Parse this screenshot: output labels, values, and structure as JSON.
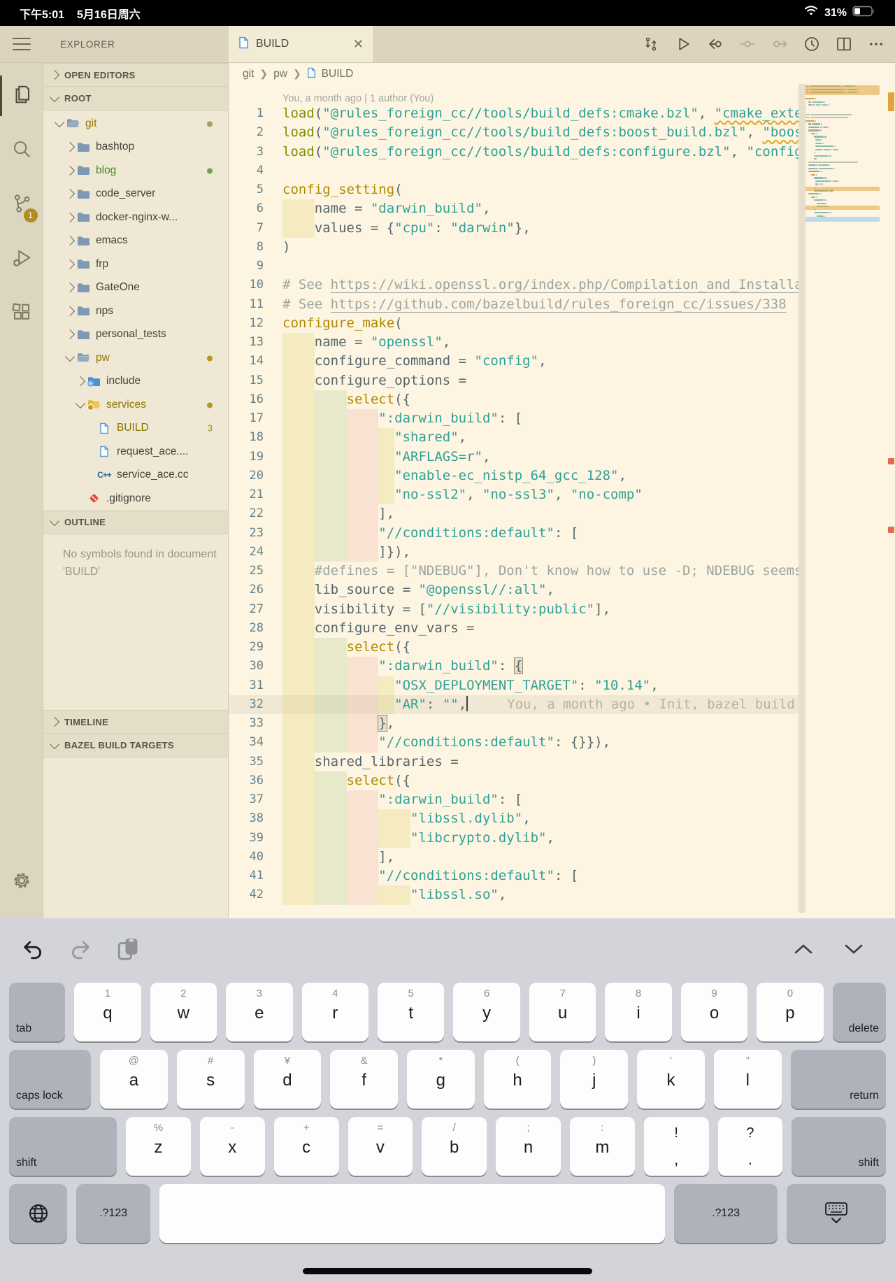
{
  "status": {
    "time": "下午5:01",
    "date": "5月16日周六",
    "battery": "31%"
  },
  "activity_bar": {
    "scm_badge": "1",
    "items": [
      "explorer",
      "search",
      "source-control",
      "run-debug",
      "extensions"
    ]
  },
  "explorer": {
    "title": "EXPLORER",
    "open_editors_label": "OPEN EDITORS",
    "root_label": "ROOT",
    "outline_label": "OUTLINE",
    "outline_message": "No symbols found in document 'BUILD'",
    "timeline_label": "TIMELINE",
    "bazel_label": "BAZEL BUILD TARGETS",
    "tree": [
      {
        "name": "git",
        "depth": 0,
        "state": "open",
        "icon": "folder-open",
        "color": "mod",
        "badge": "dot",
        "badge_color": "#AD9C6B"
      },
      {
        "name": "bashtop",
        "depth": 1,
        "state": "closed",
        "icon": "folder",
        "color": "def"
      },
      {
        "name": "blog",
        "depth": 1,
        "state": "closed",
        "icon": "folder",
        "color": "new",
        "badge": "dot",
        "badge_color": "#74A053"
      },
      {
        "name": "code_server",
        "depth": 1,
        "state": "closed",
        "icon": "folder",
        "color": "def"
      },
      {
        "name": "docker-nginx-w...",
        "depth": 1,
        "state": "closed",
        "icon": "folder",
        "color": "def"
      },
      {
        "name": "emacs",
        "depth": 1,
        "state": "closed",
        "icon": "folder",
        "color": "def"
      },
      {
        "name": "frp",
        "depth": 1,
        "state": "closed",
        "icon": "folder",
        "color": "def"
      },
      {
        "name": "GateOne",
        "depth": 1,
        "state": "closed",
        "icon": "folder",
        "color": "def"
      },
      {
        "name": "nps",
        "depth": 1,
        "state": "closed",
        "icon": "folder",
        "color": "def"
      },
      {
        "name": "personal_tests",
        "depth": 1,
        "state": "closed",
        "icon": "folder",
        "color": "def"
      },
      {
        "name": "pw",
        "depth": 1,
        "state": "open",
        "icon": "folder-open",
        "color": "mod",
        "badge": "dot",
        "badge_color": "#B59525"
      },
      {
        "name": "include",
        "depth": 2,
        "state": "closed",
        "icon": "folder-include",
        "color": "def"
      },
      {
        "name": "services",
        "depth": 2,
        "state": "open",
        "icon": "folder-services",
        "color": "mod",
        "badge": "dot",
        "badge_color": "#B59525"
      },
      {
        "name": "BUILD",
        "depth": 3,
        "state": "file",
        "icon": "file",
        "color": "mod",
        "badge": "3",
        "badge_color": "#A8891B"
      },
      {
        "name": "request_ace....",
        "depth": 3,
        "state": "file",
        "icon": "file",
        "color": "def"
      },
      {
        "name": "service_ace.cc",
        "depth": 3,
        "state": "file",
        "icon": "cpp",
        "color": "def"
      },
      {
        "name": ".gitignore",
        "depth": 2,
        "state": "file",
        "icon": "gitignore",
        "color": "def"
      }
    ]
  },
  "editor": {
    "tab_label": "BUILD",
    "breadcrumb": [
      "git",
      "pw",
      "BUILD"
    ],
    "codelens": "You, a month ago | 1 author (You)",
    "current_line": 32,
    "lines": [
      {
        "n": 1,
        "i": 0,
        "t": [
          [
            "kw",
            "load"
          ],
          [
            "p",
            "("
          ],
          [
            "str",
            "\"@rules_foreign_cc//tools/build_defs:cmake.bzl\""
          ],
          [
            "p",
            ", "
          ],
          [
            "sq",
            "\"cmake_external\""
          ],
          [
            "p",
            ")"
          ]
        ]
      },
      {
        "n": 2,
        "i": 0,
        "t": [
          [
            "kw",
            "load"
          ],
          [
            "p",
            "("
          ],
          [
            "str",
            "\"@rules_foreign_cc//tools/build_defs:boost_build.bzl\""
          ],
          [
            "p",
            ", "
          ],
          [
            "sq",
            "\"boost_build\""
          ],
          [
            "p",
            ")"
          ]
        ]
      },
      {
        "n": 3,
        "i": 0,
        "t": [
          [
            "kw",
            "load"
          ],
          [
            "p",
            "("
          ],
          [
            "str",
            "\"@rules_foreign_cc//tools/build_defs:configure.bzl\""
          ],
          [
            "p",
            ", "
          ],
          [
            "str",
            "\"configure_make\""
          ],
          [
            "p",
            ")"
          ]
        ]
      },
      {
        "n": 4,
        "i": 0,
        "t": []
      },
      {
        "n": 5,
        "i": 0,
        "t": [
          [
            "fn",
            "config_setting"
          ],
          [
            "p",
            "("
          ]
        ]
      },
      {
        "n": 6,
        "i": 4,
        "t": [
          [
            "df",
            "name"
          ],
          [
            "p",
            " = "
          ],
          [
            "str",
            "\"darwin_build\""
          ],
          [
            "p",
            ","
          ]
        ]
      },
      {
        "n": 7,
        "i": 4,
        "t": [
          [
            "df",
            "values"
          ],
          [
            "p",
            " = {"
          ],
          [
            "str",
            "\"cpu\""
          ],
          [
            "p",
            ": "
          ],
          [
            "str",
            "\"darwin\""
          ],
          [
            "p",
            "},"
          ]
        ]
      },
      {
        "n": 8,
        "i": 0,
        "t": [
          [
            "p",
            ")"
          ]
        ]
      },
      {
        "n": 9,
        "i": 0,
        "t": []
      },
      {
        "n": 10,
        "i": 0,
        "t": [
          [
            "cm",
            "# See "
          ],
          [
            "lk",
            "https://wiki.openssl.org/index.php/Compilation_and_Installation"
          ]
        ]
      },
      {
        "n": 11,
        "i": 0,
        "t": [
          [
            "cm",
            "# See "
          ],
          [
            "lk",
            "https://github.com/bazelbuild/rules_foreign_cc/issues/338"
          ]
        ]
      },
      {
        "n": 12,
        "i": 0,
        "t": [
          [
            "fn",
            "configure_make"
          ],
          [
            "p",
            "("
          ]
        ]
      },
      {
        "n": 13,
        "i": 4,
        "t": [
          [
            "df",
            "name"
          ],
          [
            "p",
            " = "
          ],
          [
            "str",
            "\"openssl\""
          ],
          [
            "p",
            ","
          ]
        ]
      },
      {
        "n": 14,
        "i": 4,
        "t": [
          [
            "df",
            "configure_command"
          ],
          [
            "p",
            " = "
          ],
          [
            "str",
            "\"config\""
          ],
          [
            "p",
            ","
          ]
        ]
      },
      {
        "n": 15,
        "i": 4,
        "t": [
          [
            "df",
            "configure_options"
          ],
          [
            "p",
            " ="
          ]
        ]
      },
      {
        "n": 16,
        "i": 8,
        "t": [
          [
            "fn",
            "select"
          ],
          [
            "p",
            "({"
          ]
        ]
      },
      {
        "n": 17,
        "i": 12,
        "t": [
          [
            "str",
            "\":darwin_build\""
          ],
          [
            "p",
            ": ["
          ]
        ]
      },
      {
        "n": 18,
        "i": 14,
        "t": [
          [
            "str",
            "\"shared\""
          ],
          [
            "p",
            ","
          ]
        ]
      },
      {
        "n": 19,
        "i": 14,
        "t": [
          [
            "str",
            "\"ARFLAGS=r\""
          ],
          [
            "p",
            ","
          ]
        ]
      },
      {
        "n": 20,
        "i": 14,
        "t": [
          [
            "str",
            "\"enable-ec_nistp_64_gcc_128\""
          ],
          [
            "p",
            ","
          ]
        ]
      },
      {
        "n": 21,
        "i": 14,
        "t": [
          [
            "str",
            "\"no-ssl2\""
          ],
          [
            "p",
            ", "
          ],
          [
            "str",
            "\"no-ssl3\""
          ],
          [
            "p",
            ", "
          ],
          [
            "str",
            "\"no-comp\""
          ]
        ]
      },
      {
        "n": 22,
        "i": 12,
        "t": [
          [
            "p",
            "],"
          ]
        ]
      },
      {
        "n": 23,
        "i": 12,
        "t": [
          [
            "str",
            "\"//conditions:default\""
          ],
          [
            "p",
            ": ["
          ]
        ]
      },
      {
        "n": 24,
        "i": 12,
        "t": [
          [
            "p",
            "]}),"
          ]
        ]
      },
      {
        "n": 25,
        "i": 4,
        "t": [
          [
            "cm",
            "#defines = [\"NDEBUG\"], Don't know how to use -D; NDEBUG seems to be defined"
          ]
        ]
      },
      {
        "n": 26,
        "i": 4,
        "t": [
          [
            "df",
            "lib_source"
          ],
          [
            "p",
            " = "
          ],
          [
            "str",
            "\"@openssl//:all\""
          ],
          [
            "p",
            ","
          ]
        ]
      },
      {
        "n": 27,
        "i": 4,
        "t": [
          [
            "df",
            "visibility"
          ],
          [
            "p",
            " = ["
          ],
          [
            "str",
            "\"//visibility:public\""
          ],
          [
            "p",
            "],"
          ]
        ]
      },
      {
        "n": 28,
        "i": 4,
        "t": [
          [
            "df",
            "configure_env_vars"
          ],
          [
            "p",
            " ="
          ]
        ]
      },
      {
        "n": 29,
        "i": 8,
        "t": [
          [
            "fn",
            "select"
          ],
          [
            "p",
            "({"
          ]
        ]
      },
      {
        "n": 30,
        "i": 12,
        "t": [
          [
            "str",
            "\":darwin_build\""
          ],
          [
            "p",
            ": "
          ],
          [
            "bm",
            "{"
          ]
        ]
      },
      {
        "n": 31,
        "i": 14,
        "t": [
          [
            "str",
            "\"OSX_DEPLOYMENT_TARGET\""
          ],
          [
            "p",
            ": "
          ],
          [
            "str",
            "\"10.14\""
          ],
          [
            "p",
            ","
          ]
        ]
      },
      {
        "n": 32,
        "i": 14,
        "t": [
          [
            "str",
            "\"AR\""
          ],
          [
            "p",
            ": "
          ],
          [
            "str",
            "\"\""
          ],
          [
            "p",
            ","
          ]
        ],
        "cursor": true,
        "blame": "You, a month ago • Init, bazel build openssl"
      },
      {
        "n": 33,
        "i": 12,
        "t": [
          [
            "bm",
            "}"
          ],
          [
            "p",
            ","
          ]
        ]
      },
      {
        "n": 34,
        "i": 12,
        "t": [
          [
            "str",
            "\"//conditions:default\""
          ],
          [
            "p",
            ": {}}),"
          ]
        ]
      },
      {
        "n": 35,
        "i": 4,
        "t": [
          [
            "df",
            "shared_libraries"
          ],
          [
            "p",
            " ="
          ]
        ]
      },
      {
        "n": 36,
        "i": 8,
        "t": [
          [
            "fn",
            "select"
          ],
          [
            "p",
            "({"
          ]
        ]
      },
      {
        "n": 37,
        "i": 12,
        "t": [
          [
            "str",
            "\":darwin_build\""
          ],
          [
            "p",
            ": ["
          ]
        ]
      },
      {
        "n": 38,
        "i": 16,
        "t": [
          [
            "str",
            "\"libssl.dylib\""
          ],
          [
            "p",
            ","
          ]
        ]
      },
      {
        "n": 39,
        "i": 16,
        "t": [
          [
            "str",
            "\"libcrypto.dylib\""
          ],
          [
            "p",
            ","
          ]
        ]
      },
      {
        "n": 40,
        "i": 12,
        "t": [
          [
            "p",
            "],"
          ]
        ]
      },
      {
        "n": 41,
        "i": 12,
        "t": [
          [
            "str",
            "\"//conditions:default\""
          ],
          [
            "p",
            ": ["
          ]
        ]
      },
      {
        "n": 42,
        "i": 16,
        "t": [
          [
            "str",
            "\"libssl.so\""
          ],
          [
            "p",
            ","
          ]
        ]
      }
    ],
    "toolbar_icons": [
      "compare-changes-icon",
      "run-icon",
      "navigate-back-icon",
      "center-layout-icon",
      "navigate-forward-icon",
      "history-icon",
      "split-editor-icon",
      "more-actions-icon"
    ]
  },
  "colors": {
    "accent_gold": "#B08A00",
    "string_teal": "#2FA198",
    "keyword_olive": "#7E8F01",
    "editor_bg": "#FDF5E1",
    "sidebar_bg": "#EFE8D4",
    "modified_band": "#E2A33C",
    "current_line_band": "#9EC9EA"
  },
  "keyboard": {
    "rows": [
      [
        {
          "k": "special",
          "label": "tab",
          "flex": 0.84,
          "align": "bl"
        },
        {
          "k": "letter",
          "main": "q",
          "sub": "1"
        },
        {
          "k": "letter",
          "main": "w",
          "sub": "2"
        },
        {
          "k": "letter",
          "main": "e",
          "sub": "3"
        },
        {
          "k": "letter",
          "main": "r",
          "sub": "4"
        },
        {
          "k": "letter",
          "main": "t",
          "sub": "5"
        },
        {
          "k": "letter",
          "main": "y",
          "sub": "6"
        },
        {
          "k": "letter",
          "main": "u",
          "sub": "7"
        },
        {
          "k": "letter",
          "main": "i",
          "sub": "8"
        },
        {
          "k": "letter",
          "main": "o",
          "sub": "9"
        },
        {
          "k": "letter",
          "main": "p",
          "sub": "0"
        },
        {
          "k": "special",
          "label": "delete",
          "flex": 0.8,
          "align": "br"
        }
      ],
      [
        {
          "k": "special",
          "label": "caps lock",
          "flex": 1.21,
          "align": "bl"
        },
        {
          "k": "letter",
          "main": "a",
          "sub": "@"
        },
        {
          "k": "letter",
          "main": "s",
          "sub": "#"
        },
        {
          "k": "letter",
          "main": "d",
          "sub": "¥"
        },
        {
          "k": "letter",
          "main": "f",
          "sub": "&"
        },
        {
          "k": "letter",
          "main": "g",
          "sub": "*"
        },
        {
          "k": "letter",
          "main": "h",
          "sub": "("
        },
        {
          "k": "letter",
          "main": "j",
          "sub": ")"
        },
        {
          "k": "letter",
          "main": "k",
          "sub": "'"
        },
        {
          "k": "letter",
          "main": "l",
          "sub": "”"
        },
        {
          "k": "special",
          "label": "return",
          "flex": 1.41,
          "align": "br"
        }
      ],
      [
        {
          "k": "special",
          "label": "shift",
          "flex": 1.66,
          "align": "bl"
        },
        {
          "k": "letter",
          "main": "z",
          "sub": "%"
        },
        {
          "k": "letter",
          "main": "x",
          "sub": "-"
        },
        {
          "k": "letter",
          "main": "c",
          "sub": "+"
        },
        {
          "k": "letter",
          "main": "v",
          "sub": "="
        },
        {
          "k": "letter",
          "main": "b",
          "sub": "/"
        },
        {
          "k": "letter",
          "main": "n",
          "sub": ";"
        },
        {
          "k": "letter",
          "main": "m",
          "sub": ":"
        },
        {
          "k": "dual",
          "top": "!",
          "bottom": ","
        },
        {
          "k": "dual",
          "top": "?",
          "bottom": "."
        },
        {
          "k": "special",
          "label": "shift",
          "flex": 1.45,
          "align": "br"
        }
      ],
      [
        {
          "k": "icon",
          "icon": "globe-icon",
          "flex": 0.84
        },
        {
          "k": "special",
          "label": ".?123",
          "flex": 1.07,
          "align": "c"
        },
        {
          "k": "space",
          "flex": 7.3
        },
        {
          "k": "special",
          "label": ".?123",
          "flex": 1.5,
          "align": "c"
        },
        {
          "k": "icon",
          "icon": "keyboard-dismiss-icon",
          "flex": 1.43
        }
      ]
    ]
  }
}
